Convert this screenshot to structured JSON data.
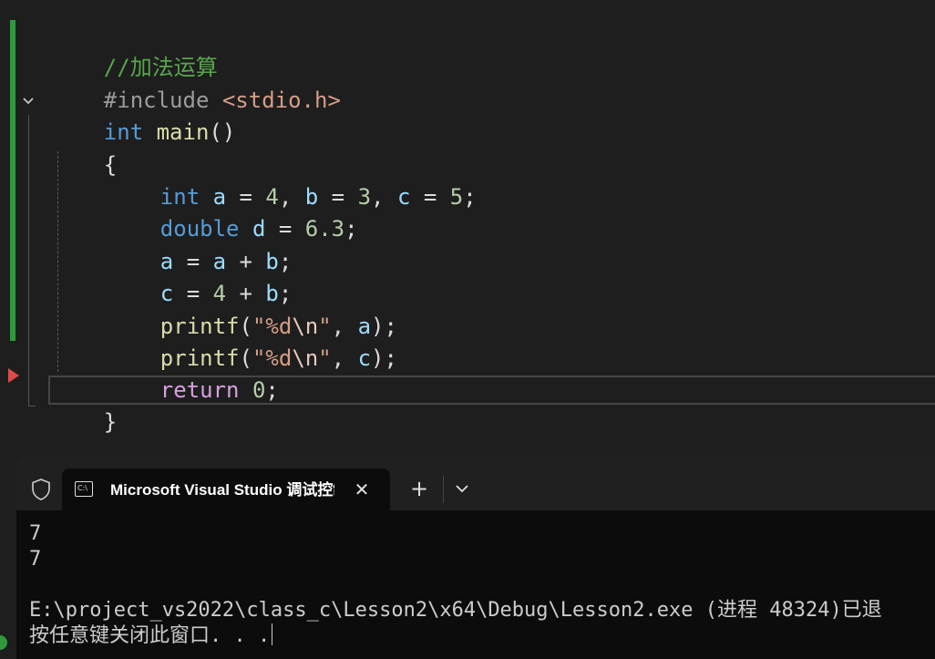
{
  "editor": {
    "lines": {
      "l1": {
        "comment": "//加法运算"
      },
      "l2": {
        "directive": "#include",
        "header": "<stdio.h>"
      },
      "l3": {
        "kw": "int",
        "fn": "main",
        "paren": "()"
      },
      "l4": {
        "brace": "{"
      },
      "l5": {
        "kw": "int",
        "a": "a",
        "eq1": " = ",
        "n1": "4",
        "c1": ", ",
        "b": "b",
        "eq2": " = ",
        "n2": "3",
        "c2": ", ",
        "c": "c",
        "eq3": " = ",
        "n3": "5",
        "semi": ";"
      },
      "l6": {
        "kw": "double",
        "d": "d",
        "eq": " = ",
        "n": "6.3",
        "semi": ";"
      },
      "l7": {
        "a1": "a",
        "eq": " = ",
        "a2": "a",
        "plus": " + ",
        "b": "b",
        "semi": ";"
      },
      "l8": {
        "c": "c",
        "eq": " = ",
        "n": "4",
        "plus": " + ",
        "b": "b",
        "semi": ";"
      },
      "l9": {
        "fn": "printf",
        "open": "(",
        "q1": "\"",
        "fmt": "%d",
        "esc": "\\n",
        "q2": "\"",
        "sep": ", ",
        "arg": "a",
        "close": ");"
      },
      "l10": {
        "fn": "printf",
        "open": "(",
        "q1": "\"",
        "fmt": "%d",
        "esc": "\\n",
        "q2": "\"",
        "sep": ", ",
        "arg": "c",
        "close": ");"
      },
      "l11": {
        "kw": "return",
        "sp": " ",
        "n": "0",
        "semi": ";"
      },
      "l12": {
        "brace": "}"
      }
    }
  },
  "console": {
    "tab_title": "Microsoft Visual Studio 调试控制台",
    "tab_icon_text": "C:\\",
    "close_glyph": "✕",
    "new_tab_glyph": "+",
    "output": {
      "line1": "7",
      "line2": "7",
      "line3": "E:\\project_vs2022\\class_c\\Lesson2\\x64\\Debug\\Lesson2.exe (进程 48324)已退",
      "line4": "按任意键关闭此窗口. . ."
    }
  },
  "colors": {
    "comment": "#57a64a",
    "keyword": "#569cd6",
    "function": "#dcdcaa",
    "variable": "#9cdcfe",
    "number": "#b5cea8",
    "string": "#d69d85",
    "control": "#d8a0df",
    "change_bar": "#2f9a3a",
    "breakpoint_arrow": "#e04a4a"
  }
}
